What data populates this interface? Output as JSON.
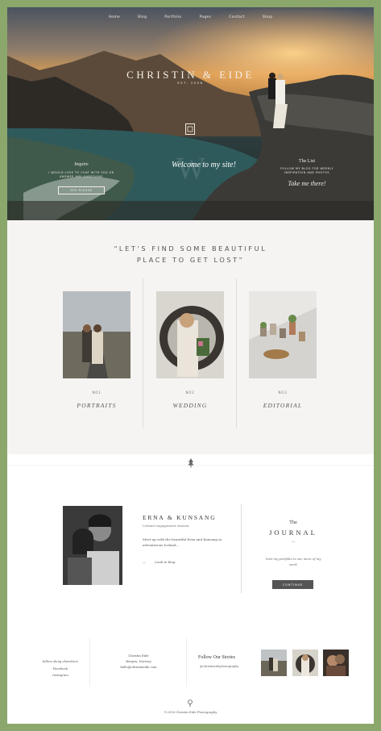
{
  "nav": {
    "items": [
      "Home",
      "Blog",
      "Portfolio",
      "Pages",
      "Contact",
      "Shop"
    ]
  },
  "hero": {
    "logo": "CHRISTIN & EIDE",
    "established": "EST. 2008",
    "welcome": "Welcome to my site!",
    "watermark": "W",
    "left_title": "Inquire",
    "left_text": "I WOULD LOVE TO CHAT WITH YOU OR ANSWER ANY QUESTIONS",
    "left_button": "YES PLEASE",
    "right_title": "The List",
    "right_text": "FOLLOW MY BLOG FOR WEEKLY INSPIRATION AND PHOTOS",
    "right_cta": "Take me there!"
  },
  "quote": {
    "line1": "\"LET'S FIND SOME BEAUTIFUL",
    "line2": "PLACE TO GET LOST\""
  },
  "categories": [
    {
      "number": "NO1",
      "name": "PORTRAITS"
    },
    {
      "number": "NO2",
      "name": "WEDDING"
    },
    {
      "number": "NO3",
      "name": "EDITORIAL"
    }
  ],
  "about": {
    "couple_name": "ERNA & KUNSANG",
    "couple_sub": "Iceland engagement session",
    "couple_text": "Meet up with the beautiful Erna and Kunsang in adventurous Iceland...",
    "couple_link_arrow": "—",
    "couple_link": "Look to blog"
  },
  "journal": {
    "the": "The",
    "title": "JOURNAL",
    "dash": "—",
    "text": "Visit my portfolio to see more of my work",
    "button": "CONTINUE"
  },
  "footer": {
    "social": [
      "follow along elsewhere",
      "Facebook",
      "Instagram"
    ],
    "contact": [
      "Christin Eide",
      "Bergen, Norway",
      "hello@christineide.com"
    ],
    "follow_title": "Follow Our Stories",
    "follow_handle": "@christineidephotography",
    "copyright": "©2016 Christin Eide Photography"
  },
  "colors": {
    "frame": "#8ba76c",
    "section_bg": "#f6f4f2",
    "button": "#555555"
  },
  "icons": [
    "tree-icon",
    "pin-icon",
    "frame-icon"
  ]
}
